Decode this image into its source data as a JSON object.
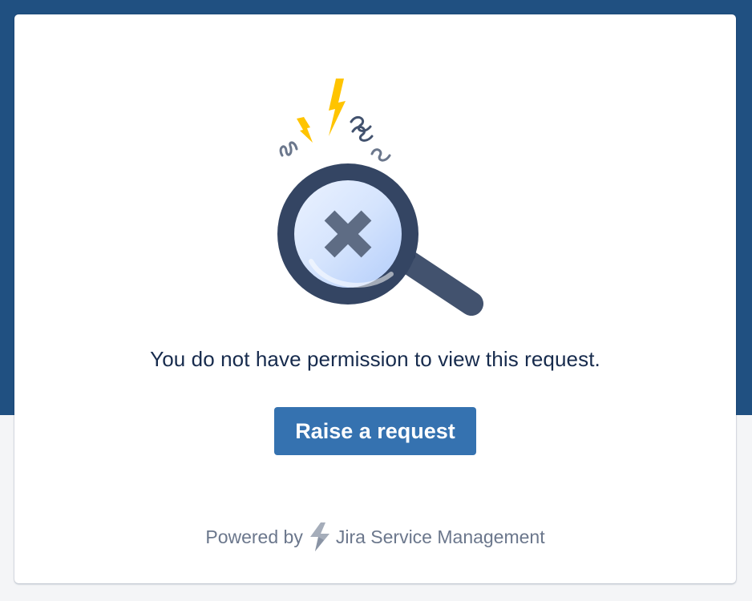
{
  "message": {
    "text": "You do not have permission to view this request."
  },
  "actions": {
    "raise_request_label": "Raise a request"
  },
  "footer": {
    "powered_by": "Powered by",
    "product_name": "Jira Service Management"
  },
  "icons": {
    "illustration": "magnifying-glass-error-illustration",
    "product_logo": "jira-service-management-logo-icon"
  },
  "colors": {
    "header_background": "#205081",
    "button_background": "#3572b0",
    "text_primary": "#172b4d",
    "text_secondary": "#6b778c",
    "accent_yellow": "#ffc400"
  }
}
